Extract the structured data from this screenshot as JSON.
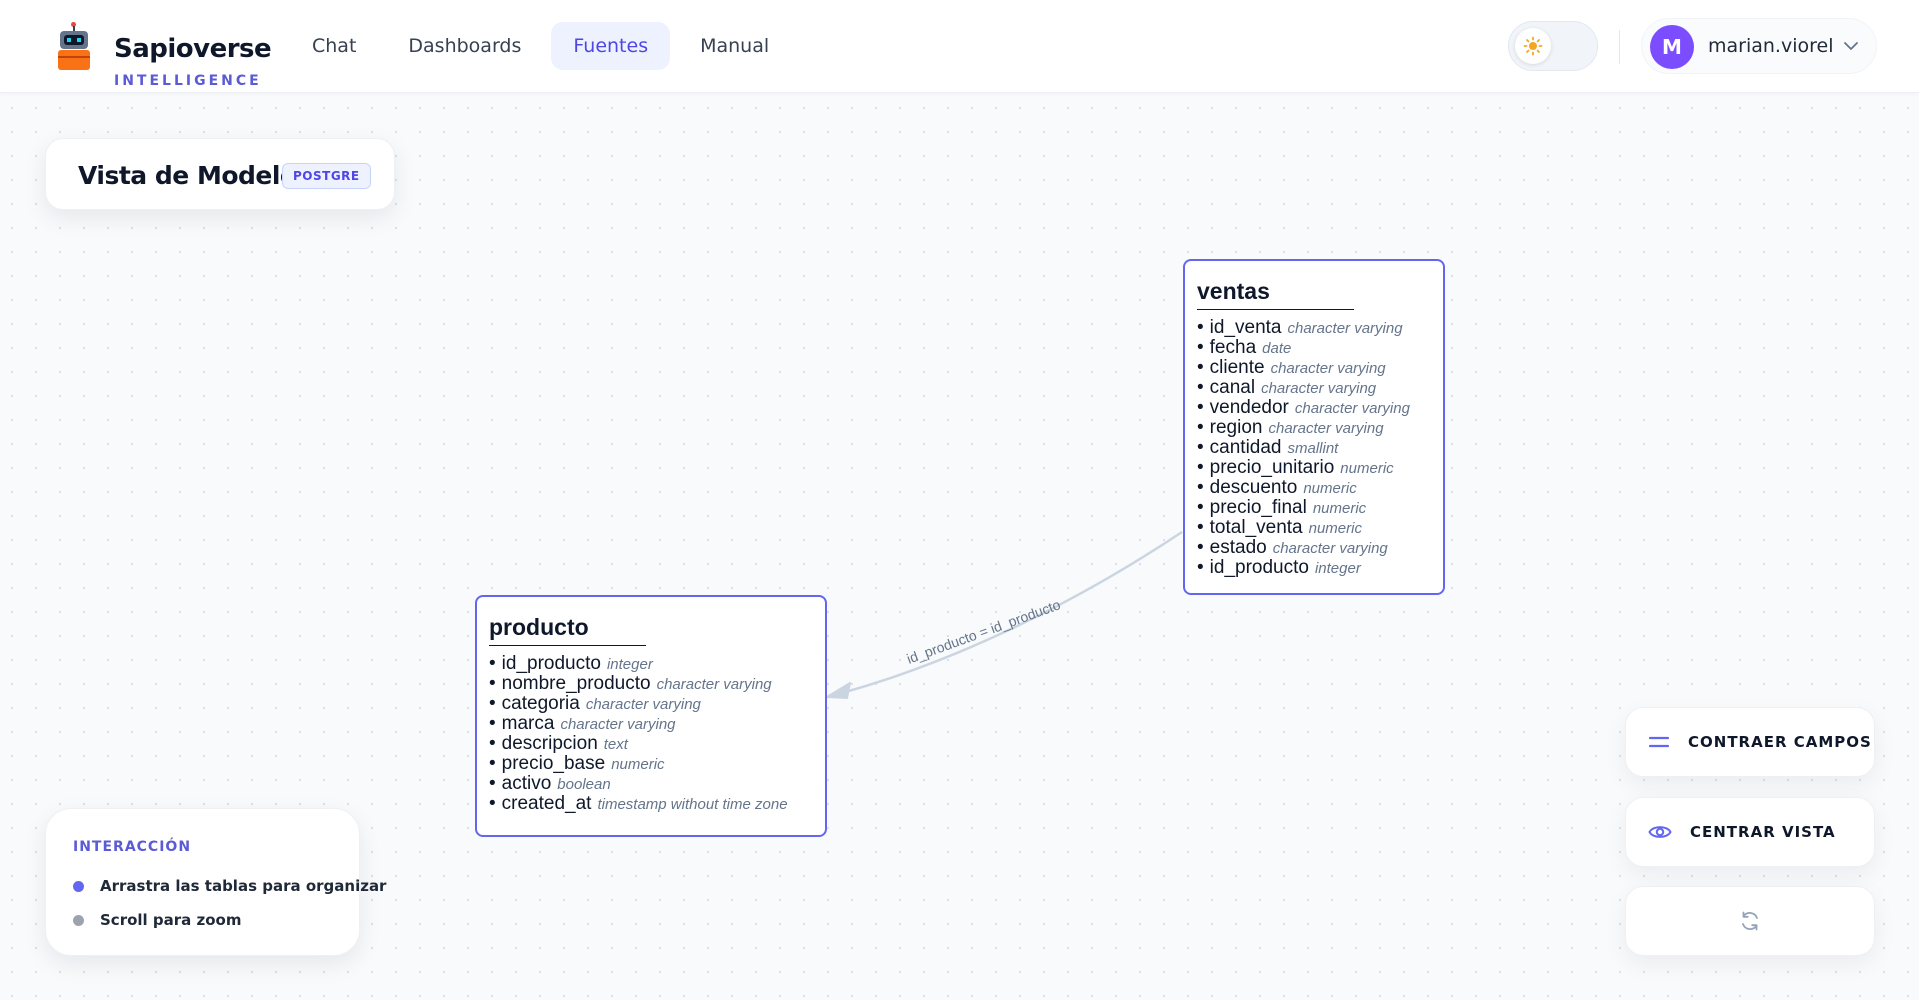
{
  "brand": {
    "name": "Sapioverse",
    "subtitle": "INTELLIGENCE"
  },
  "nav": {
    "items": [
      {
        "label": "Chat",
        "active": false
      },
      {
        "label": "Dashboards",
        "active": false
      },
      {
        "label": "Fuentes",
        "active": true
      },
      {
        "label": "Manual",
        "active": false
      }
    ]
  },
  "user": {
    "initial": "M",
    "name": "marian.viorel",
    "avatar_color": "#7c4dff"
  },
  "theme": {
    "mode_icon": "sun-icon",
    "sun_color": "#f5a524"
  },
  "model_view": {
    "title": "Vista de Modelo",
    "badge": "POSTGRE"
  },
  "tables": {
    "ventas": {
      "name": "ventas",
      "fields": [
        {
          "name": "id_venta",
          "type": "character varying"
        },
        {
          "name": "fecha",
          "type": "date"
        },
        {
          "name": "cliente",
          "type": "character varying"
        },
        {
          "name": "canal",
          "type": "character varying"
        },
        {
          "name": "vendedor",
          "type": "character varying"
        },
        {
          "name": "region",
          "type": "character varying"
        },
        {
          "name": "cantidad",
          "type": "smallint"
        },
        {
          "name": "precio_unitario",
          "type": "numeric"
        },
        {
          "name": "descuento",
          "type": "numeric"
        },
        {
          "name": "precio_final",
          "type": "numeric"
        },
        {
          "name": "total_venta",
          "type": "numeric"
        },
        {
          "name": "estado",
          "type": "character varying"
        },
        {
          "name": "id_producto",
          "type": "integer"
        }
      ]
    },
    "producto": {
      "name": "producto",
      "fields": [
        {
          "name": "id_producto",
          "type": "integer"
        },
        {
          "name": "nombre_producto",
          "type": "character varying"
        },
        {
          "name": "categoria",
          "type": "character varying"
        },
        {
          "name": "marca",
          "type": "character varying"
        },
        {
          "name": "descripcion",
          "type": "text"
        },
        {
          "name": "precio_base",
          "type": "numeric"
        },
        {
          "name": "activo",
          "type": "boolean"
        },
        {
          "name": "created_at",
          "type": "timestamp without time zone"
        }
      ]
    }
  },
  "relation": {
    "label": "id_producto = id_producto"
  },
  "interaction": {
    "heading": "INTERACCIÓN",
    "items": [
      {
        "text": "Arrastra las tablas para organizar",
        "dot_color": "#6366f1"
      },
      {
        "text": "Scroll para zoom",
        "dot_color": "#9ca3af"
      }
    ]
  },
  "actions": {
    "collapse_label": "CONTRAER CAMPOS",
    "center_label": "CENTRAR VISTA",
    "refresh_icon": "refresh-icon"
  },
  "colors": {
    "accent": "#6366f1",
    "accent_text": "#4f46e5",
    "edge": "#cbd5e1"
  }
}
